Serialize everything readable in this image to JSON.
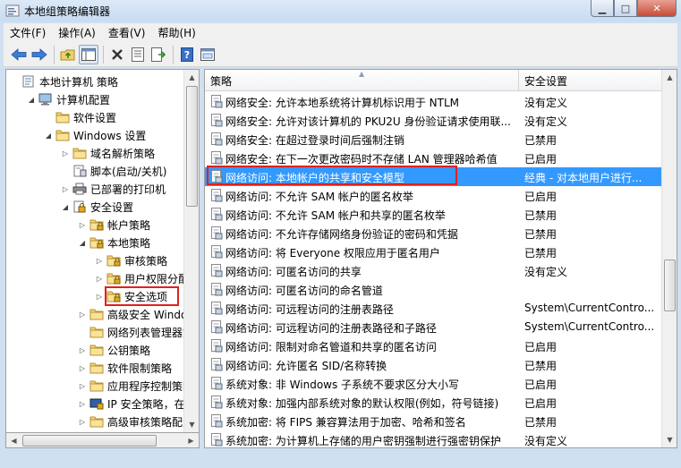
{
  "window": {
    "title": "本地组策略编辑器"
  },
  "menu": [
    "文件(F)",
    "操作(A)",
    "查看(V)",
    "帮助(H)"
  ],
  "toolbar": [
    "back-icon",
    "forward-icon",
    "up-folder-icon",
    "show-hide-tree-icon",
    "delete-icon",
    "properties-icon",
    "export-list-icon",
    "help-icon",
    "console-icon"
  ],
  "tree": [
    {
      "label": "本地计算机 策略",
      "depth": 0,
      "toggle": "",
      "icon": "computer-policy"
    },
    {
      "label": "计算机配置",
      "depth": 1,
      "toggle": "◢",
      "icon": "computer"
    },
    {
      "label": "软件设置",
      "depth": 2,
      "toggle": "",
      "icon": "folder"
    },
    {
      "label": "Windows 设置",
      "depth": 2,
      "toggle": "◢",
      "icon": "folder"
    },
    {
      "label": "域名解析策略",
      "depth": 3,
      "toggle": "▷",
      "icon": "folder"
    },
    {
      "label": "脚本(启动/关机)",
      "depth": 3,
      "toggle": "",
      "icon": "script"
    },
    {
      "label": "已部署的打印机",
      "depth": 3,
      "toggle": "▷",
      "icon": "printer"
    },
    {
      "label": "安全设置",
      "depth": 3,
      "toggle": "◢",
      "icon": "security"
    },
    {
      "label": "帐户策略",
      "depth": 4,
      "toggle": "▷",
      "icon": "folder-lock"
    },
    {
      "label": "本地策略",
      "depth": 4,
      "toggle": "◢",
      "icon": "folder-lock"
    },
    {
      "label": "审核策略",
      "depth": 5,
      "toggle": "▷",
      "icon": "folder-lock"
    },
    {
      "label": "用户权限分配",
      "depth": 5,
      "toggle": "▷",
      "icon": "folder-lock"
    },
    {
      "label": "安全选项",
      "depth": 5,
      "toggle": "▷",
      "icon": "folder-lock",
      "selected": true
    },
    {
      "label": "高级安全 Windows",
      "depth": 4,
      "toggle": "▷",
      "icon": "folder"
    },
    {
      "label": "网络列表管理器策",
      "depth": 4,
      "toggle": "",
      "icon": "folder"
    },
    {
      "label": "公钥策略",
      "depth": 4,
      "toggle": "▷",
      "icon": "folder"
    },
    {
      "label": "软件限制策略",
      "depth": 4,
      "toggle": "▷",
      "icon": "folder"
    },
    {
      "label": "应用程序控制策略",
      "depth": 4,
      "toggle": "▷",
      "icon": "folder"
    },
    {
      "label": "IP 安全策略，在 本",
      "depth": 4,
      "toggle": "▷",
      "icon": "ip-security"
    },
    {
      "label": "高级审核策略配置",
      "depth": 4,
      "toggle": "▷",
      "icon": "folder"
    }
  ],
  "columns": {
    "policy": "策略",
    "setting": "安全设置"
  },
  "rows": [
    {
      "policy": "网络安全: 允许本地系统将计算机标识用于 NTLM",
      "setting": "没有定义"
    },
    {
      "policy": "网络安全: 允许对该计算机的 PKU2U 身份验证请求使用联...",
      "setting": "没有定义"
    },
    {
      "policy": "网络安全: 在超过登录时间后强制注销",
      "setting": "已禁用"
    },
    {
      "policy": "网络安全: 在下一次更改密码时不存储 LAN 管理器哈希值",
      "setting": "已启用"
    },
    {
      "policy": "网络访问: 本地帐户的共享和安全模型",
      "setting": "经典 - 对本地用户进行...",
      "selected": true
    },
    {
      "policy": "网络访问: 不允许 SAM 帐户的匿名枚举",
      "setting": "已启用"
    },
    {
      "policy": "网络访问: 不允许 SAM 帐户和共享的匿名枚举",
      "setting": "已禁用"
    },
    {
      "policy": "网络访问: 不允许存储网络身份验证的密码和凭据",
      "setting": "已禁用"
    },
    {
      "policy": "网络访问: 将 Everyone 权限应用于匿名用户",
      "setting": "已禁用"
    },
    {
      "policy": "网络访问: 可匿名访问的共享",
      "setting": "没有定义"
    },
    {
      "policy": "网络访问: 可匿名访问的命名管道",
      "setting": ""
    },
    {
      "policy": "网络访问: 可远程访问的注册表路径",
      "setting": "System\\CurrentContro..."
    },
    {
      "policy": "网络访问: 可远程访问的注册表路径和子路径",
      "setting": "System\\CurrentContro..."
    },
    {
      "policy": "网络访问: 限制对命名管道和共享的匿名访问",
      "setting": "已启用"
    },
    {
      "policy": "网络访问: 允许匿名 SID/名称转换",
      "setting": "已禁用"
    },
    {
      "policy": "系统对象: 非 Windows 子系统不要求区分大小写",
      "setting": "已启用"
    },
    {
      "policy": "系统对象: 加强内部系统对象的默认权限(例如，符号链接)",
      "setting": "已启用"
    },
    {
      "policy": "系统加密: 将 FIPS 兼容算法用于加密、哈希和签名",
      "setting": "已禁用"
    },
    {
      "policy": "系统加密: 为计算机上存储的用户密钥强制进行强密钥保护",
      "setting": "没有定义"
    }
  ],
  "colors": {
    "selection": "#3399ff",
    "highlight_box": "#e02020",
    "titlebar": "#c8dcf1"
  }
}
